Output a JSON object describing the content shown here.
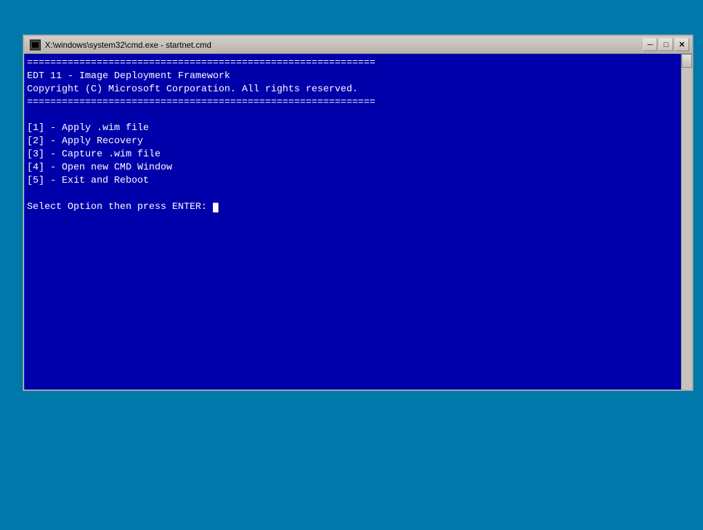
{
  "window": {
    "title": "X:\\windows\\system32\\cmd.exe - startnet.cmd",
    "title_icon_alt": "cmd-icon"
  },
  "titlebar": {
    "minimize_label": "─",
    "restore_label": "□",
    "close_label": "✕"
  },
  "console": {
    "separator": "============================================================",
    "line1": "EDT 11 - Image Deployment Framework",
    "line2": "Copyright (C) Microsoft Corporation. All rights reserved.",
    "blank1": "",
    "menu1": "[1] - Apply .wim file",
    "menu2": "[2] - Apply Recovery",
    "menu3": "[3] - Capture .wim file",
    "menu4": "[4] - Open new CMD Window",
    "menu5": "[5] - Exit and Reboot",
    "blank2": "",
    "prompt": "Select Option then press ENTER: "
  }
}
